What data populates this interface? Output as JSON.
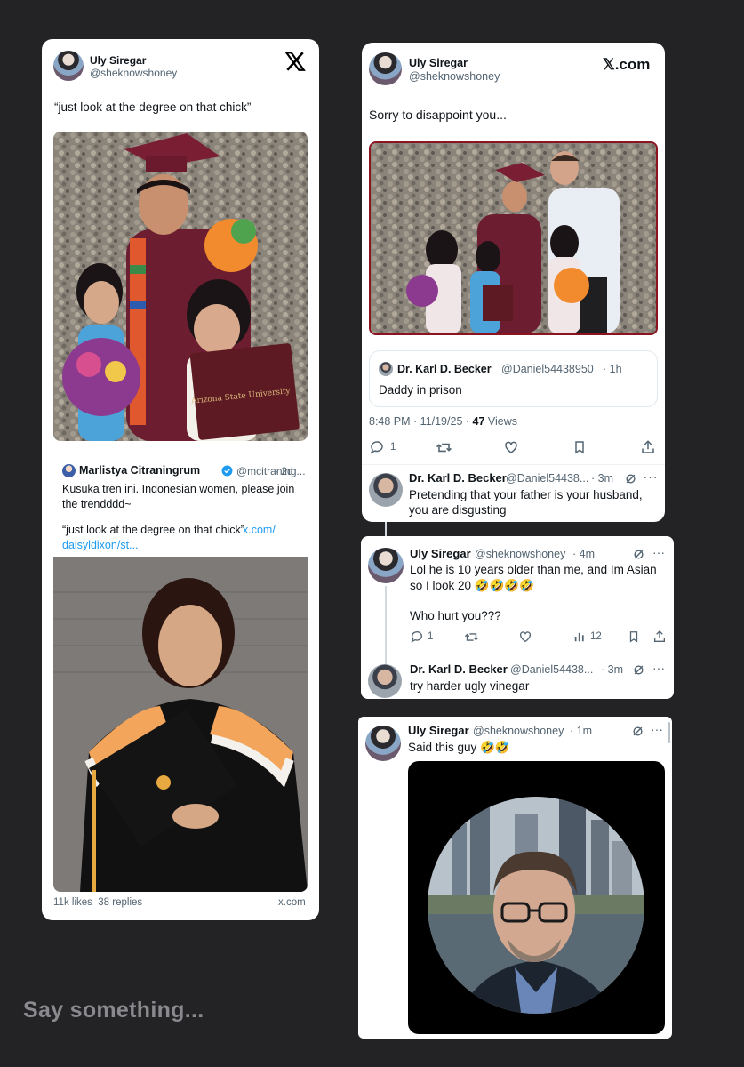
{
  "card1": {
    "name": "Uly Siregar",
    "handle": "@sheknowshoney",
    "logo": "X",
    "text": "“just look at the degree on that chick”",
    "quote": {
      "name": "Marlistya Citraningrum",
      "handle": "@mcitraning...",
      "time": "· 2d",
      "text": "Kusuka tren ini. Indonesian women, please join the trendddd~",
      "text2": "“just look at the degree on that chick”",
      "link": "x.com/\ndaisyldixon/st..."
    },
    "footer_stats": "11k likes  38 replies",
    "footer_site": "x.com"
  },
  "card2": {
    "name": "Uly Siregar",
    "handle": "@sheknowshoney",
    "logo": "𝕏.com",
    "text": "Sorry to disappoint you...",
    "quote": {
      "name": "Dr. Karl D. Becker",
      "handle": "@Daniel54438950",
      "time": "· 1h",
      "text": "Daddy in prison"
    },
    "meta_time": "8:48 PM · 11/19/25 ·",
    "meta_views_count": "47",
    "meta_views_label": "Views",
    "reply_count": "1",
    "reply": {
      "name": "Dr. Karl D. Becker",
      "handle": "@Daniel54438...",
      "time": "· 3m",
      "text": "Pretending that your father is your husband, you are disgusting"
    }
  },
  "card3": {
    "name": "Uly Siregar",
    "handle": "@sheknowshoney",
    "time": "· 4m",
    "text": "Lol he is 10 years older than me, and Im Asian so I look 20 🤣🤣🤣🤣",
    "text2": "Who hurt you???",
    "reply_count": "1",
    "views": "12",
    "reply": {
      "name": "Dr. Karl D. Becker",
      "handle": "@Daniel54438...",
      "time": "· 3m",
      "text": "try harder ugly vinegar"
    }
  },
  "card4": {
    "name": "Uly Siregar",
    "handle": "@sheknowshoney",
    "time": "· 1m",
    "text": "Said this guy 🤣🤣"
  },
  "composer": {
    "placeholder": "Say something..."
  },
  "icons": [
    "x-logo-icon",
    "reply-icon",
    "retweet-icon",
    "like-icon",
    "bookmark-icon",
    "share-icon",
    "views-icon",
    "grok-icon",
    "more-icon",
    "verified-badge-icon"
  ]
}
